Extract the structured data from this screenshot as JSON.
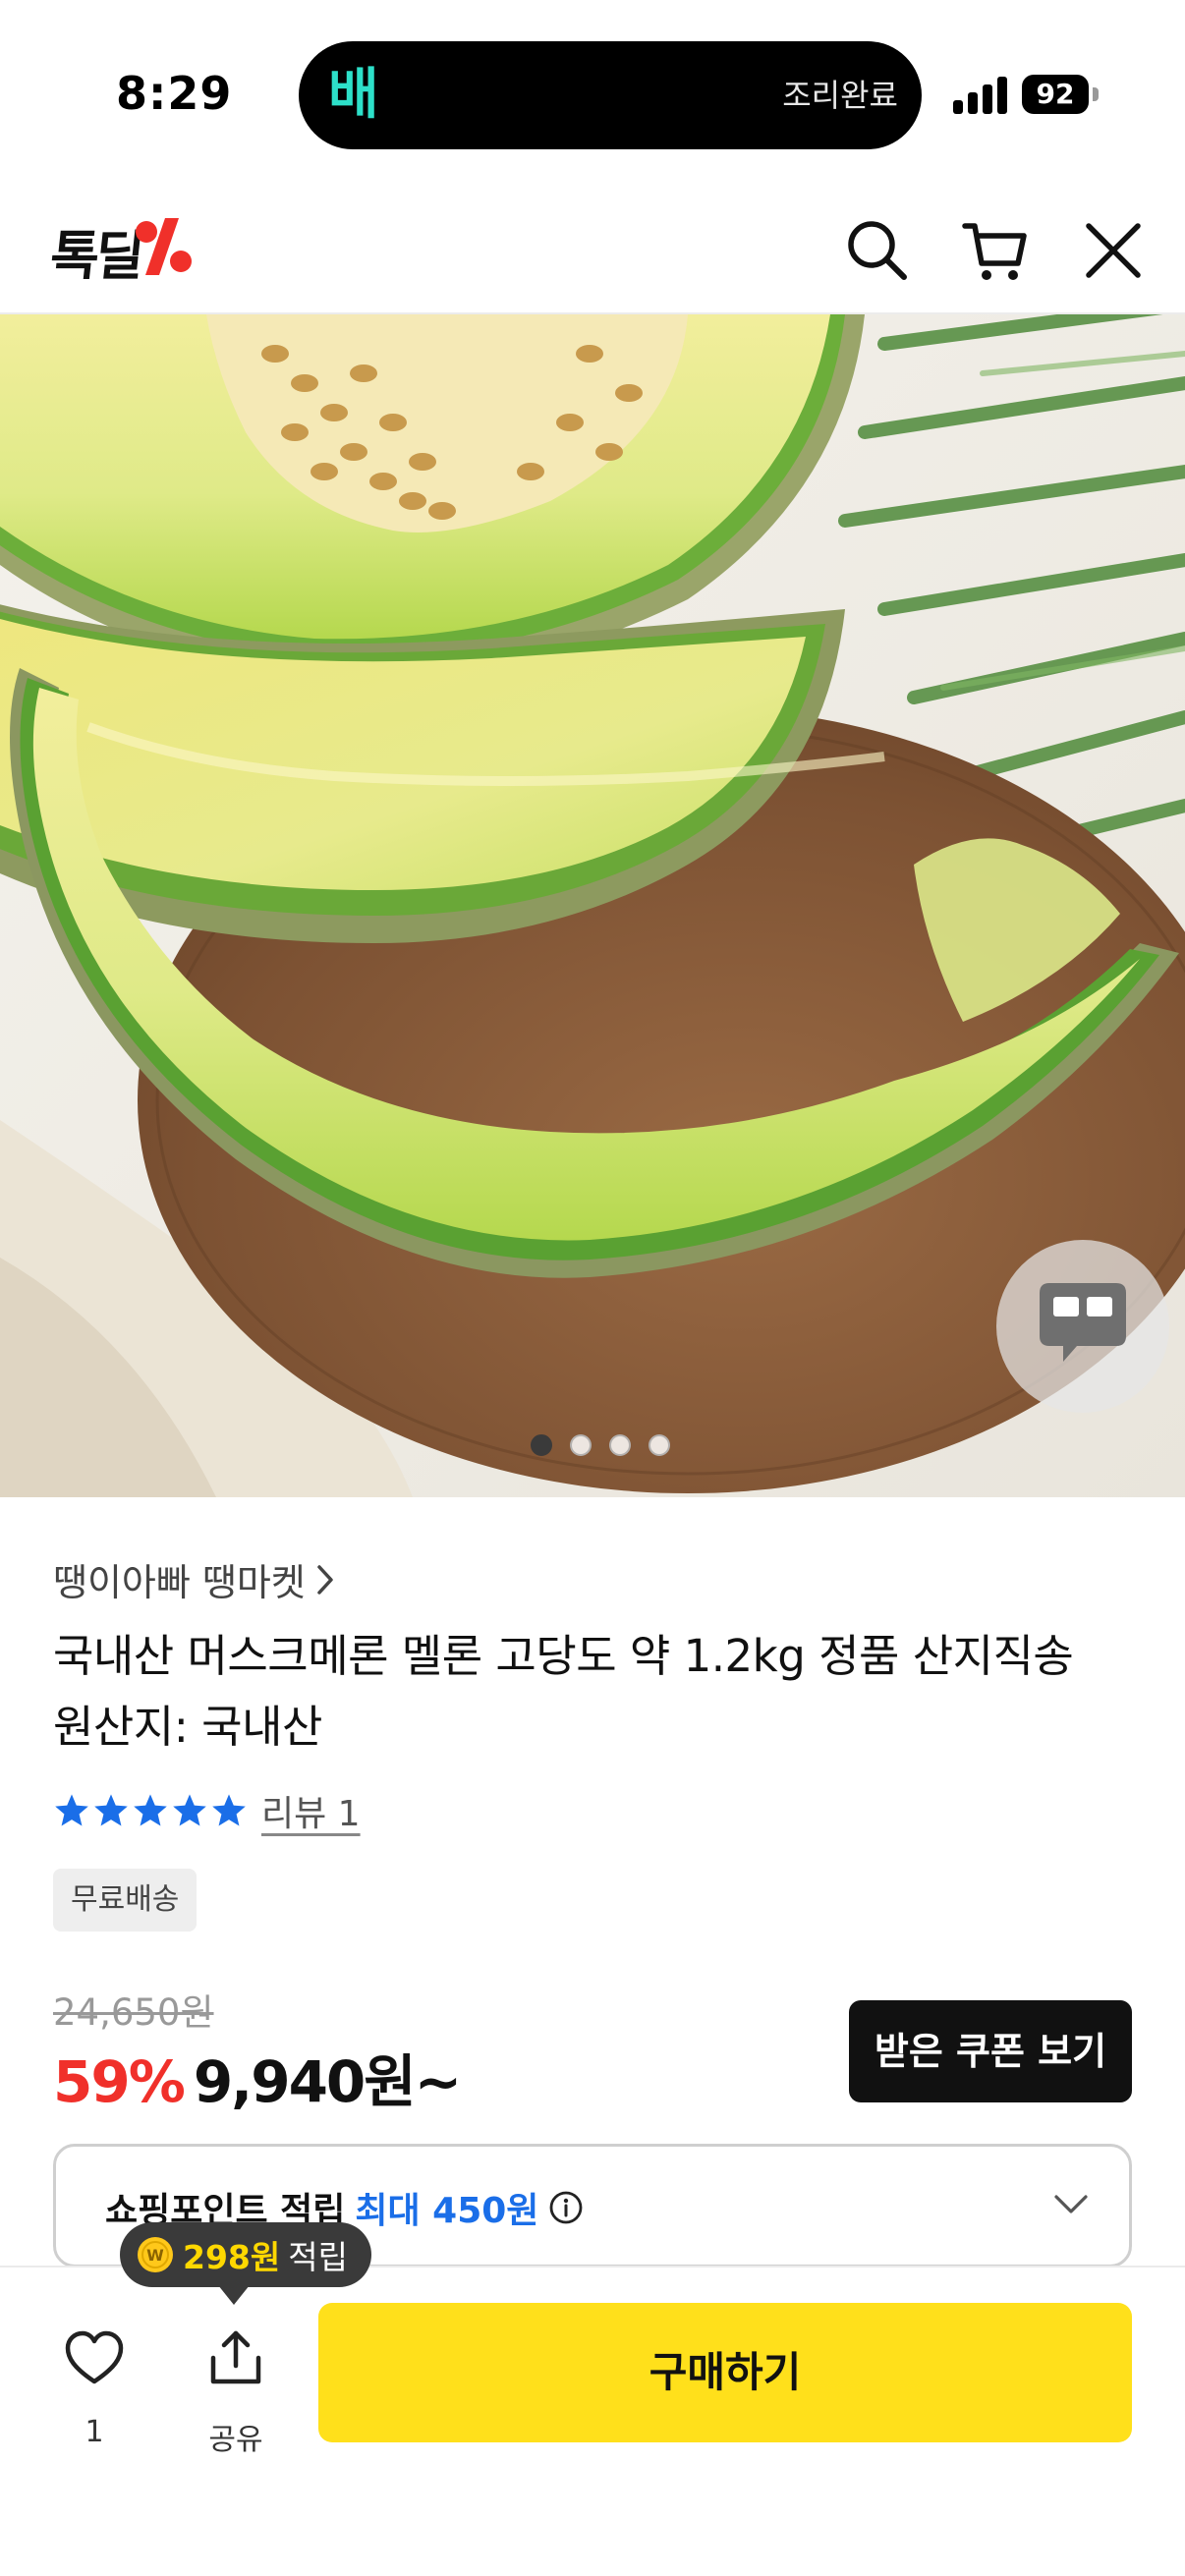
{
  "status_bar": {
    "time": "8:29",
    "island_app_icon": "배",
    "island_text": "조리완료",
    "battery": "92"
  },
  "header": {
    "logo_text": "톡딜",
    "icons": [
      "search-icon",
      "cart-icon",
      "close-icon"
    ]
  },
  "hero": {
    "carousel_count": 4,
    "carousel_active": 1
  },
  "product": {
    "seller": "땡이아빠 땡마켓",
    "title_line1": "국내산 머스크메론 멜론 고당도 약 1.2kg 정품 산지직송",
    "title_line2": "원산지: 국내산",
    "rating_stars": 5,
    "review_label": "리뷰 1",
    "free_shipping_badge": "무료배송",
    "original_price": "24,650원",
    "discount": "59%",
    "price": "9,940원~",
    "coupon_button": "받은 쿠폰 보기"
  },
  "points": {
    "label": "쇼핑포인트 적립",
    "max": "최대 450원",
    "tooltip_amount": "298원",
    "tooltip_suffix": "적립"
  },
  "bottom_bar": {
    "like_count": "1",
    "share_label": "공유",
    "buy_label": "구매하기"
  },
  "colors": {
    "brand_red": "#f0302a",
    "buy_yellow": "#ffe01b",
    "star_blue": "#1a6ee8",
    "points_blue": "#1a6ee8"
  }
}
